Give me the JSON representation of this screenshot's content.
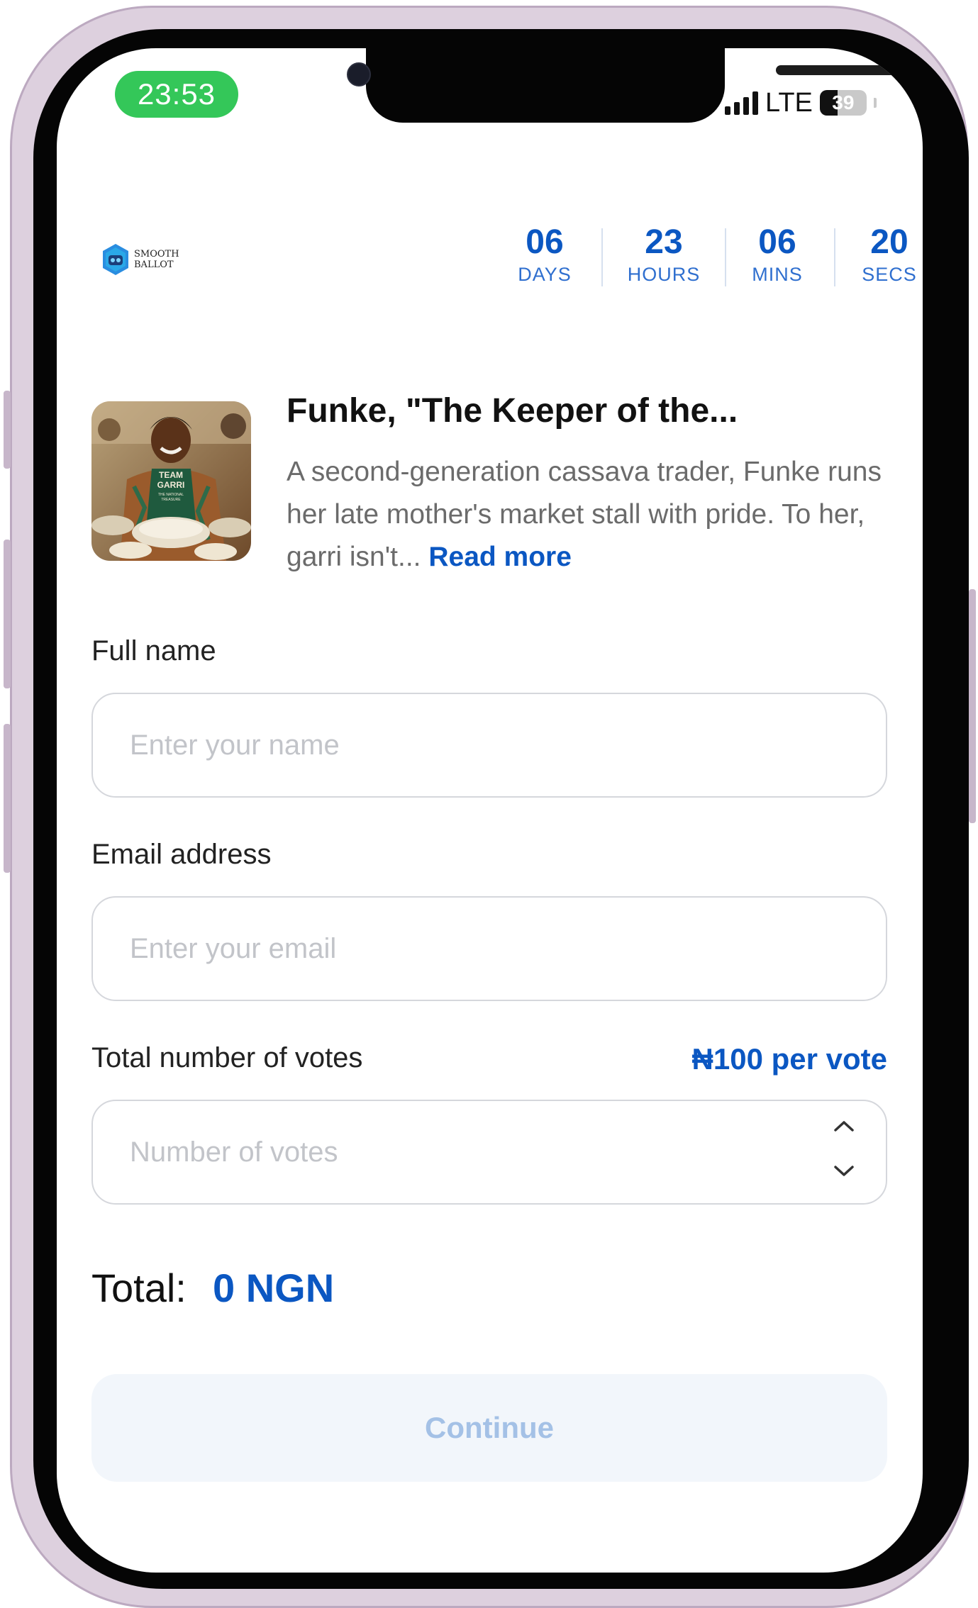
{
  "status_bar": {
    "time": "23:53",
    "network": "LTE",
    "battery": "39"
  },
  "header": {
    "logo": {
      "line1": "SMOOTH",
      "line2": "BALLOT"
    },
    "countdown": [
      {
        "value": "06",
        "label": "DAYS"
      },
      {
        "value": "23",
        "label": "HOURS"
      },
      {
        "value": "06",
        "label": "MINS"
      },
      {
        "value": "20",
        "label": "SECS"
      }
    ]
  },
  "candidate": {
    "name": "Funke, \"The Keeper of the...",
    "bio": "A second-generation cassava trader, Funke runs her late mother's market stall with pride. To her, garri isn't...",
    "read_more": "Read more",
    "photo_apron_text": [
      "TEAM",
      "GARRI",
      "THE NATIONAL",
      "TREASURE"
    ]
  },
  "form": {
    "full_name": {
      "label": "Full name",
      "placeholder": "Enter your name",
      "value": ""
    },
    "email": {
      "label": "Email address",
      "placeholder": "Enter your email",
      "value": ""
    },
    "votes": {
      "label": "Total number of votes",
      "price": "₦100 per vote",
      "placeholder": "Number of votes",
      "value": ""
    }
  },
  "total": {
    "label": "Total:",
    "value": "0 NGN"
  },
  "continue_label": "Continue",
  "colors": {
    "accent": "#0b57c2",
    "time_pill": "#34c759",
    "button_disabled_bg": "#f2f6fb"
  }
}
